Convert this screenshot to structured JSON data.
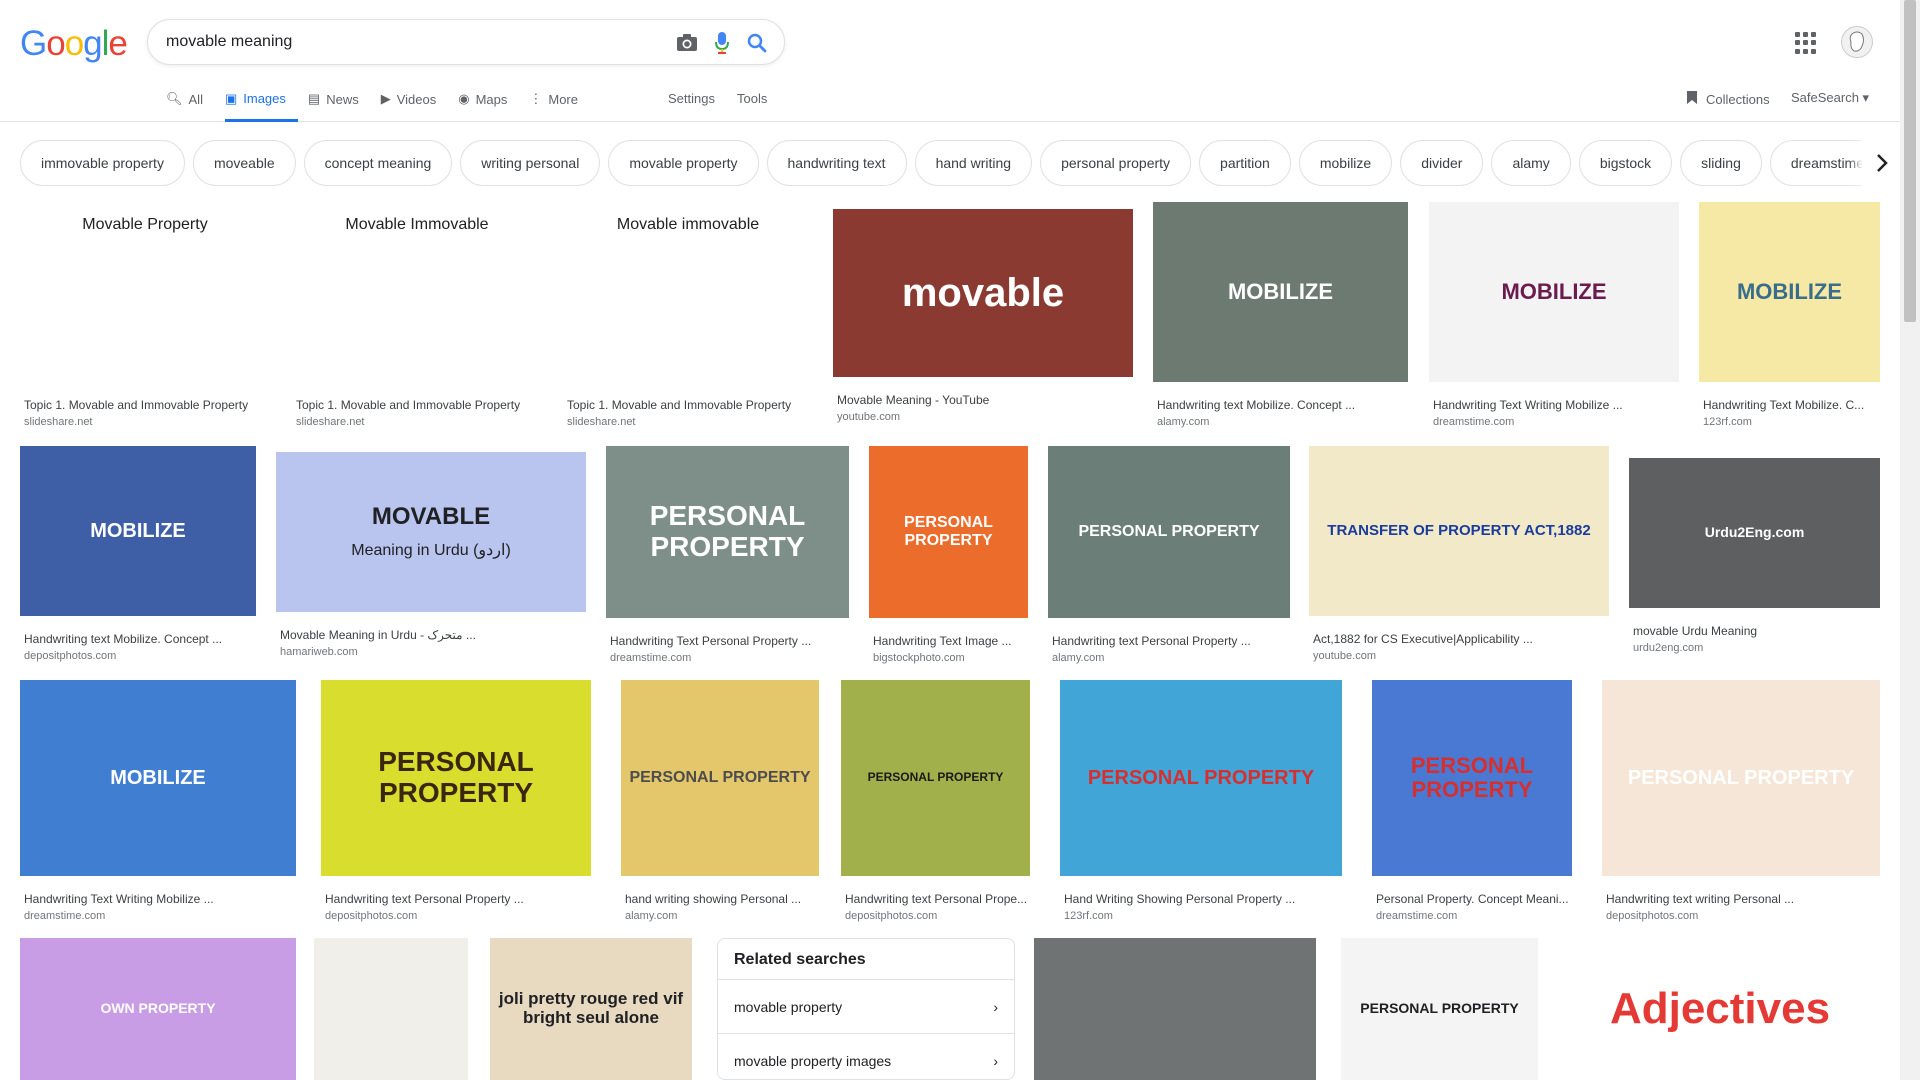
{
  "logo": [
    "G",
    "o",
    "o",
    "g",
    "l",
    "e"
  ],
  "search": {
    "query": "movable meaning"
  },
  "tabs": [
    {
      "label": "All",
      "icon": "search-icon"
    },
    {
      "label": "Images",
      "icon": "image-icon",
      "active": true
    },
    {
      "label": "News",
      "icon": "news-icon"
    },
    {
      "label": "Videos",
      "icon": "video-icon"
    },
    {
      "label": "Maps",
      "icon": "map-icon"
    },
    {
      "label": "More",
      "icon": "more-vert-icon"
    }
  ],
  "tools": {
    "settings": "Settings",
    "tools": "Tools"
  },
  "collections": "Collections",
  "safesearch": "SafeSearch ▾",
  "chips": [
    "immovable property",
    "moveable",
    "concept meaning",
    "writing personal",
    "movable property",
    "handwriting text",
    "hand writing",
    "personal property",
    "partition",
    "mobilize",
    "divider",
    "alamy",
    "bigstock",
    "sliding",
    "dreamstime"
  ],
  "results": [
    {
      "title": "Topic 1. Movable and Immovable Property",
      "source": "slideshare.net",
      "thumb_text": "Movable Property"
    },
    {
      "title": "Topic 1. Movable and Immovable Property",
      "source": "slideshare.net",
      "thumb_text": "Movable      Immovable"
    },
    {
      "title": "Topic 1. Movable and Immovable Property",
      "source": "slideshare.net",
      "thumb_text": "Movable      immovable"
    },
    {
      "title": "Movable Meaning - YouTube",
      "source": "youtube.com",
      "thumb_text": "movable"
    },
    {
      "title": "Handwriting text Mobilize. Concept ...",
      "source": "alamy.com",
      "thumb_text": "MOBILIZE"
    },
    {
      "title": "Handwriting Text Writing Mobilize ...",
      "source": "dreamstime.com",
      "thumb_text": "MOBILIZE"
    },
    {
      "title": "Handwriting Text Mobilize. C...",
      "source": "123rf.com",
      "thumb_text": "MOBILIZE"
    },
    {
      "title": "Handwriting text Mobilize. Concept ...",
      "source": "depositphotos.com",
      "thumb_text": "MOBILIZE"
    },
    {
      "title": "Movable Meaning in Urdu - متحرک ...",
      "source": "hamariweb.com",
      "thumb_text": "MOVABLE",
      "thumb_sub": "Meaning in Urdu (اردو)"
    },
    {
      "title": "Handwriting Text Personal Property ...",
      "source": "dreamstime.com",
      "thumb_text": "PERSONAL PROPERTY"
    },
    {
      "title": "Handwriting Text Image ...",
      "source": "bigstockphoto.com",
      "thumb_text": "PERSONAL PROPERTY"
    },
    {
      "title": "Handwriting text Personal Property ...",
      "source": "alamy.com",
      "thumb_text": "PERSONAL PROPERTY"
    },
    {
      "title": "Act,1882 for CS Executive|Applicability ...",
      "source": "youtube.com",
      "thumb_text": "TRANSFER OF PROPERTY ACT,1882"
    },
    {
      "title": "movable Urdu Meaning",
      "source": "urdu2eng.com",
      "thumb_text": "Urdu2Eng.com"
    },
    {
      "title": "Handwriting Text Writing Mobilize ...",
      "source": "dreamstime.com",
      "thumb_text": "MOBILIZE"
    },
    {
      "title": "Handwriting text Personal Property ...",
      "source": "depositphotos.com",
      "thumb_text": "PERSONAL PROPERTY"
    },
    {
      "title": "hand writing showing Personal ...",
      "source": "alamy.com",
      "thumb_text": "PERSONAL PROPERTY"
    },
    {
      "title": "Handwriting text Personal Prope...",
      "source": "depositphotos.com",
      "thumb_text": "PERSONAL PROPERTY"
    },
    {
      "title": "Hand Writing Showing Personal Property ...",
      "source": "123rf.com",
      "thumb_text": "PERSONAL PROPERTY"
    },
    {
      "title": "Personal Property. Concept Meani...",
      "source": "dreamstime.com",
      "thumb_text": "PERSONAL PROPERTY"
    },
    {
      "title": "Handwriting text writing Personal ...",
      "source": "depositphotos.com",
      "thumb_text": "PERSONAL PROPERTY"
    },
    {
      "title": "",
      "source": "",
      "thumb_text": "OWN PROPERTY"
    },
    {
      "title": "",
      "source": "",
      "thumb_text": ""
    },
    {
      "title": "",
      "source": "",
      "thumb_text": "joli pretty rouge red vif bright seul alone"
    },
    {
      "title": "",
      "source": "",
      "thumb_text": ""
    },
    {
      "title": "",
      "source": "",
      "thumb_text": "PERSONAL PROPERTY"
    },
    {
      "title": "",
      "source": "",
      "thumb_text": "Adjectives"
    }
  ],
  "related": {
    "heading": "Related searches",
    "items": [
      "movable property",
      "movable property images"
    ]
  },
  "colors": {
    "accent": "#1a73e8",
    "chip_border": "#dfe1e5"
  }
}
